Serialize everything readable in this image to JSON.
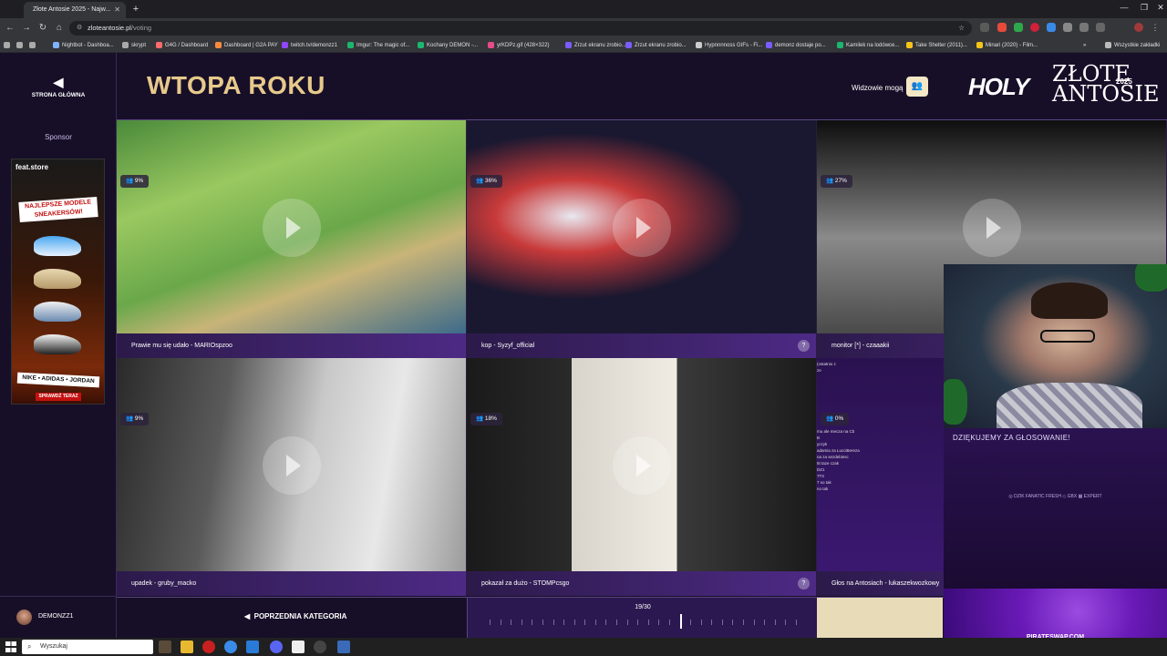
{
  "browser": {
    "tab_title": "Złote Antosie 2025 - Najw...",
    "url_host": "zloteantosie.pl",
    "url_path": "/voting",
    "bookmarks": [
      {
        "label": "Nightbot - Dashboa...",
        "color": "#7fb3ff"
      },
      {
        "label": "skrypt",
        "color": "#aaaaaa"
      },
      {
        "label": "G4G / Dashboard",
        "color": "#ff6b6b"
      },
      {
        "label": "Dashboard | G2A PAY",
        "color": "#ff8a3d"
      },
      {
        "label": "twitch.tv/demonzz1",
        "color": "#9146ff"
      },
      {
        "label": "Imgur: The magic of...",
        "color": "#1bb76e"
      },
      {
        "label": "Kochany DEMON -...",
        "color": "#1bb76e"
      },
      {
        "label": "yrKDPz.gif (428×322)",
        "color": "#e84a8a"
      },
      {
        "label": "Zrzut ekranu zrobio...",
        "color": "#7a5cff"
      },
      {
        "label": "Zrzut ekranu zrobio...",
        "color": "#7a5cff"
      },
      {
        "label": "Hypnnnnoss GIFs - Fi...",
        "color": "#cccccc"
      },
      {
        "label": "demonz dostaje po...",
        "color": "#7a5cff"
      },
      {
        "label": "Kamilek na lodówce...",
        "color": "#1bb76e"
      },
      {
        "label": "Take Shelter (2011)...",
        "color": "#f5c518"
      },
      {
        "label": "Minari (2020) - Film...",
        "color": "#f5c518"
      }
    ],
    "all_bookmarks_label": "Wszystkie zakładki"
  },
  "sidebar": {
    "home_label": "STRONA GŁÓWNA",
    "sponsor_label": "Sponsor",
    "ad": {
      "brand": "feat.store",
      "headline": "NAJLEPSZE MODELE SNEAKERSÓW!",
      "brands": "NIKE • ADIDAS • JORDAN",
      "cta": "SPRAWDŹ TERAZ"
    },
    "username": "DEMONZZ1"
  },
  "header": {
    "title": "WTOPA ROKU",
    "viewers_label": "Widzowie mogą",
    "logo_holy": "HOLY",
    "logo_zlote": "ZŁOTE",
    "logo_antosie": "ANTOSIE",
    "logo_year": "2025"
  },
  "entries": [
    {
      "caption": "Prawie mu się udało - MARIOspzoo",
      "percent": "9%",
      "help": false
    },
    {
      "caption": "kop - Syzyf_official",
      "percent": "36%",
      "help": true
    },
    {
      "caption": "monitor [*] - czaaakii",
      "percent": "27%",
      "help": false
    },
    {
      "caption": "upadek - gruby_macko",
      "percent": "9%",
      "help": false
    },
    {
      "caption": "pokazał za dużo - STOMPcsgo",
      "percent": "18%",
      "help": true
    },
    {
      "caption": "Głos na Antosiach - lukaszekwozkowy",
      "percent": "0%",
      "help": true
    }
  ],
  "footer": {
    "prev_category": "POPRZEDNIA KATEGORIA",
    "progress_text": "19/30",
    "progress_current": 19,
    "progress_total": 30
  },
  "overlay": {
    "thanks_text": "DZIĘKUJEMY ZA GŁOSOWANIE!",
    "sponsors_row": "◎ DZIK   FANATIC   FRESH   ◇ GBX   ▦ EXPERT",
    "chat_lines": [
      "(ostatnio z",
      "ze",
      "mu ale mecza na Cb",
      "B",
      "yczyk",
      "adamia za LucciBereza",
      "na za sezdebiesc",
      "5t taze czak",
      "DZ1",
      "7T3",
      "7 so tak",
      "no tak"
    ],
    "promo_label": "PIRATESWAP.COM"
  },
  "taskbar": {
    "search_placeholder": "Wyszukaj"
  }
}
